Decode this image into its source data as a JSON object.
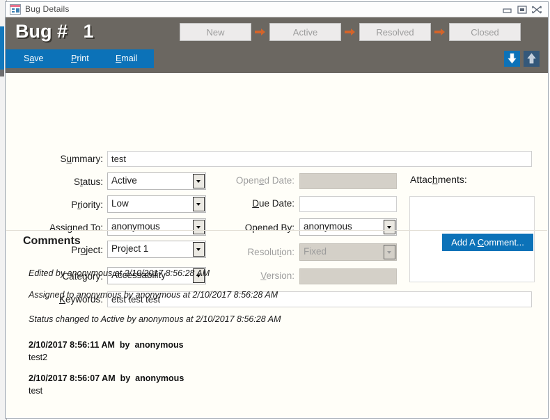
{
  "titlebar": {
    "title": "Bug Details",
    "icon": "form-icon",
    "minimize": "minimize-icon",
    "maximize": "maximize-icon",
    "close": "close-icon"
  },
  "header": {
    "bug_label": "Bug #",
    "bug_number": "1",
    "accent_blue": "#0c72b8",
    "band_color": "#6b6761",
    "arrow_color": "#d4642a",
    "workflow": [
      {
        "label": "New",
        "enabled": false
      },
      {
        "label": "Active",
        "enabled": false
      },
      {
        "label": "Resolved",
        "enabled": false
      },
      {
        "label": "Closed",
        "enabled": false
      }
    ]
  },
  "actionbar": {
    "save": {
      "pre": "S",
      "accel": "a",
      "post": "ve"
    },
    "print": {
      "pre": "",
      "accel": "P",
      "post": "rint"
    },
    "email": {
      "pre": "",
      "accel": "E",
      "post": "mail"
    }
  },
  "nav": {
    "previous": "arrow-down-icon",
    "next": "arrow-up-icon"
  },
  "form": {
    "summary": {
      "label_pre": "S",
      "label_accel": "u",
      "label_post": "mmary:",
      "value": "test",
      "enabled": true
    },
    "status": {
      "label_pre": "S",
      "label_accel": "t",
      "label_post": "atus:",
      "value": "Active",
      "enabled": true
    },
    "priority": {
      "label_pre": "P",
      "label_accel": "r",
      "label_post": "iority:",
      "value": "Low",
      "enabled": true
    },
    "assigned_to": {
      "label_pre": "Assigned To:",
      "label_accel": "",
      "label_post": "",
      "value": "anonymous",
      "enabled": true
    },
    "project": {
      "label_pre": "Pr",
      "label_accel": "o",
      "label_post": "ject:",
      "value": "Project 1",
      "enabled": true
    },
    "category": {
      "label_pre": "Cate",
      "label_accel": "g",
      "label_post": "ory:",
      "value": "Accessability",
      "enabled": true
    },
    "keywords": {
      "label_pre": "",
      "label_accel": "K",
      "label_post": "eywords:",
      "value": "etst test test",
      "enabled": true
    },
    "opened_date": {
      "label_pre": "Open",
      "label_accel": "e",
      "label_post": "d Date:",
      "value": "",
      "enabled": false
    },
    "due_date": {
      "label_pre": "",
      "label_accel": "D",
      "label_post": "ue Date:",
      "value": "",
      "enabled": true
    },
    "opened_by": {
      "label_pre": "Opened By:",
      "label_accel": "",
      "label_post": "",
      "value": "anonymous",
      "enabled": true
    },
    "resolution": {
      "label_pre": "Resolut",
      "label_accel": "i",
      "label_post": "on:",
      "value": "Fixed",
      "enabled": false
    },
    "version": {
      "label_pre": "",
      "label_accel": "V",
      "label_post": "ersion:",
      "value": "",
      "enabled": false
    },
    "attachments": {
      "label_pre": "Attac",
      "label_accel": "h",
      "label_post": "ments:",
      "items": []
    }
  },
  "comments": {
    "title": "Comments",
    "add_button": {
      "pre": "Add A ",
      "accel": "C",
      "post": "omment..."
    },
    "history": [
      "Edited by anonymous at 2/10/2017 8:56:28 AM",
      "Assigned to anonymous by anonymous at 2/10/2017 8:56:28 AM",
      "Status changed to Active by anonymous at 2/10/2017 8:56:28 AM"
    ],
    "entries": [
      {
        "timestamp": "2/10/2017 8:56:11 AM",
        "by": "by",
        "author": "anonymous",
        "text": "test2"
      },
      {
        "timestamp": "2/10/2017 8:56:07 AM",
        "by": "by",
        "author": "anonymous",
        "text": "test"
      }
    ]
  }
}
